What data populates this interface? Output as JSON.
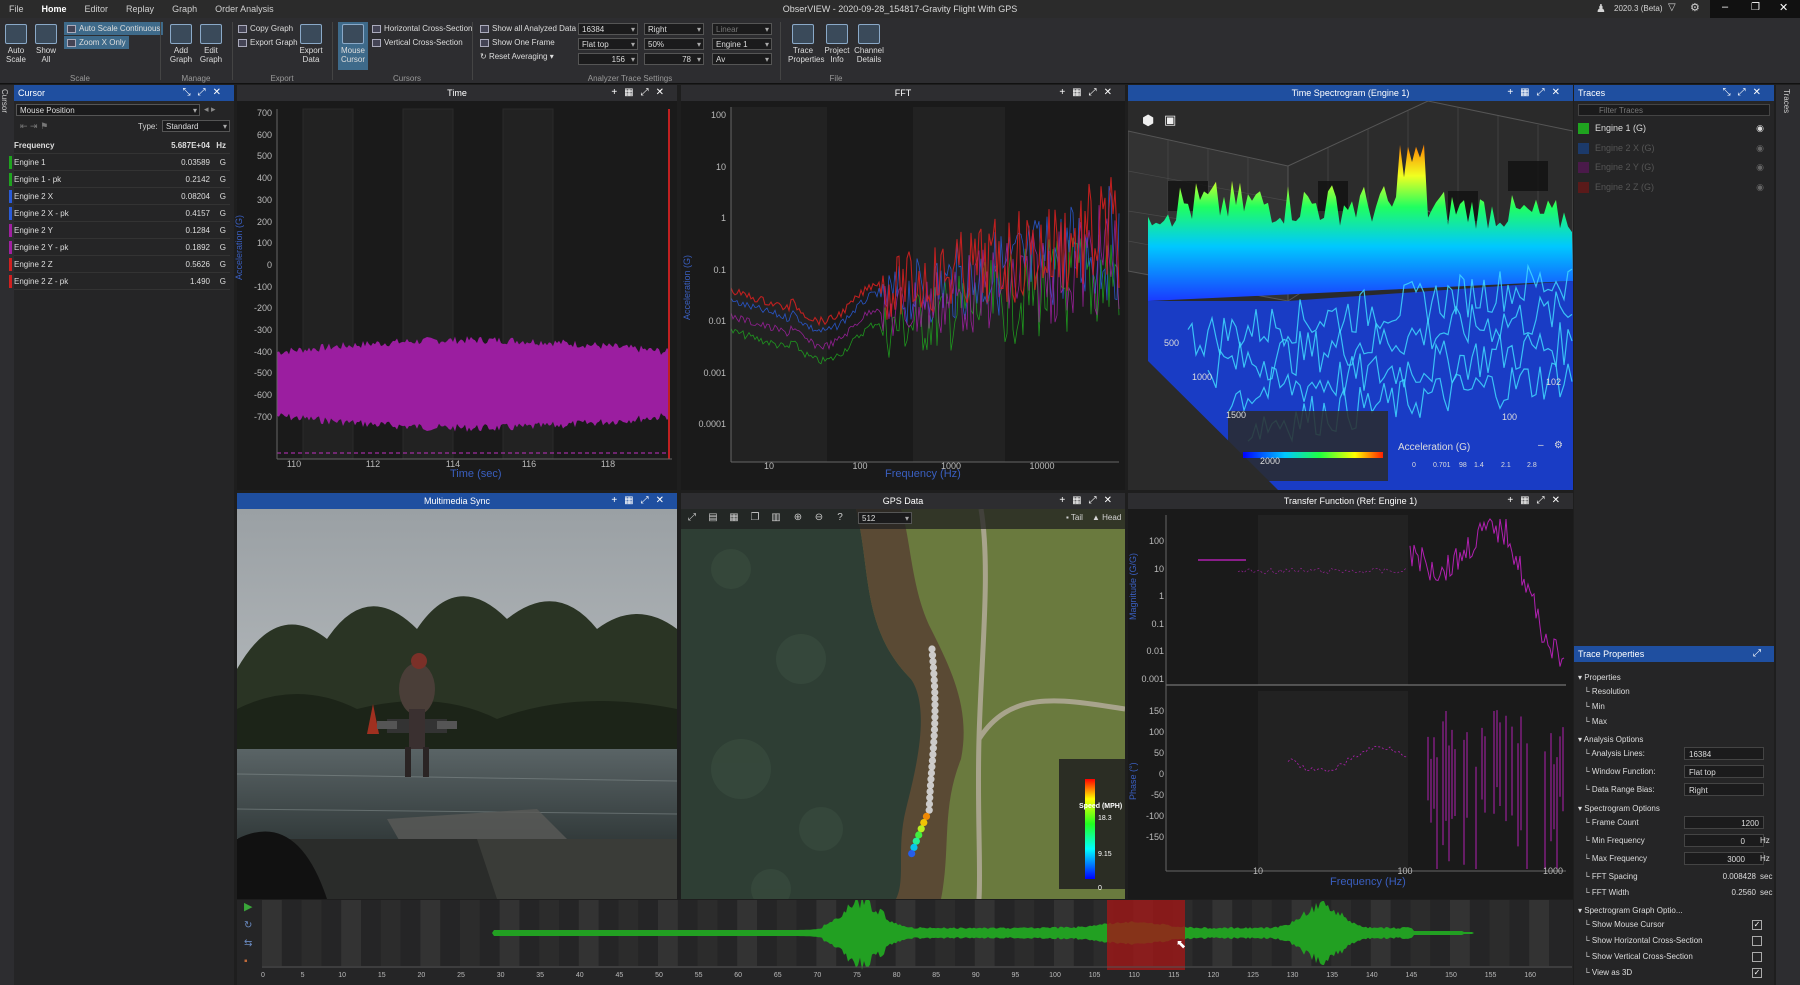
{
  "menu": {
    "tabs": [
      "File",
      "Home",
      "Editor",
      "Replay",
      "Graph",
      "Order Analysis"
    ],
    "active": "Home"
  },
  "window": {
    "title": "ObserVIEW - 2020-09-28_154817-Gravity Flight With GPS",
    "version": "2020.3 (Beta)"
  },
  "ribbon": {
    "auto_scale": "Auto Scale",
    "show_all": "Show All",
    "auto_scale_continuous": "Auto Scale Continuous",
    "zoom_x_only": "Zoom X Only",
    "add_graph": "Add Graph",
    "edit_graph": "Edit Graph",
    "copy_graph": "Copy Graph",
    "export_graph": "Export Graph",
    "export_data": "Export Data",
    "mouse_cursor": "Mouse Cursor",
    "horizontal_cross_section": "Horizontal Cross-Section",
    "vertical_cross_section": "Vertical Cross-Section",
    "show_all_analyzed": "Show all Analyzed Data",
    "show_one_frame": "Show One Frame",
    "reset_averaging": "Reset Averaging",
    "dd_lines": "16384",
    "dd_window": "Flat top",
    "dd_frames": "156",
    "dd_bias": "Right",
    "dd_overlap": "50%",
    "dd_avg": "78",
    "dd_scale": "Linear",
    "dd_ref": "Engine 1",
    "dd_type": "Av",
    "trace_properties": "Trace Properties",
    "project_info": "Project Info",
    "channel_details": "Channel Details",
    "groups": {
      "scale": "Scale",
      "manage": "Manage",
      "export": "Export",
      "cursors": "Cursors",
      "analyzer": "Analyzer Trace Settings",
      "file": "File"
    }
  },
  "cursor_panel": {
    "title": "Cursor",
    "mode": "Mouse Position",
    "type_label": "Type:",
    "type_value": "Standard",
    "header_label": "Frequency",
    "header_value": "5.687E+04",
    "header_unit": "Hz",
    "rows": [
      {
        "label": "Engine 1",
        "value": "0.03589",
        "unit": "G",
        "color": "#1fa31f"
      },
      {
        "label": "Engine 1 - pk",
        "value": "0.2142",
        "unit": "G",
        "color": "#1fa31f"
      },
      {
        "label": "Engine 2 X",
        "value": "0.08204",
        "unit": "G",
        "color": "#2a5bd8"
      },
      {
        "label": "Engine 2 X - pk",
        "value": "0.4157",
        "unit": "G",
        "color": "#2a5bd8"
      },
      {
        "label": "Engine 2 Y",
        "value": "0.1284",
        "unit": "G",
        "color": "#a020a0"
      },
      {
        "label": "Engine 2 Y - pk",
        "value": "0.1892",
        "unit": "G",
        "color": "#a020a0"
      },
      {
        "label": "Engine 2 Z",
        "value": "0.5626",
        "unit": "G",
        "color": "#d02020"
      },
      {
        "label": "Engine 2 Z - pk",
        "value": "1.490",
        "unit": "G",
        "color": "#d02020"
      }
    ]
  },
  "time_panel": {
    "title": "Time",
    "ylabel": "Acceleration (G)",
    "xlabel": "Time (sec)",
    "yticks": [
      "700",
      "600",
      "500",
      "400",
      "300",
      "200",
      "100",
      "0",
      "-100",
      "-200",
      "-300",
      "-400",
      "-500",
      "-600",
      "-700"
    ],
    "xticks": [
      "110",
      "112",
      "114",
      "116",
      "118"
    ]
  },
  "fft_panel": {
    "title": "FFT",
    "ylabel": "Acceleration (G)",
    "xlabel": "Frequency (Hz)",
    "yticks": [
      "100",
      "10",
      "1",
      "0.1",
      "0.01",
      "0.001",
      "0.0001"
    ],
    "xticks": [
      "10",
      "100",
      "1000",
      "10000"
    ]
  },
  "spectrogram_panel": {
    "title": "Time Spectrogram (Engine 1)",
    "axis_labels": [
      "500",
      "1000",
      "1500",
      "2000",
      "100",
      "102"
    ],
    "legend_title": "Acceleration (G)",
    "legend_ticks": [
      "0",
      "0.701",
      "98",
      "1.4",
      "2.1",
      "2.8"
    ]
  },
  "multimedia_panel": {
    "title": "Multimedia Sync"
  },
  "gps_panel": {
    "title": "GPS Data",
    "zoom": "512",
    "tail": "Tail",
    "head": "Head",
    "speed_title": "Speed (MPH)",
    "speed_ticks": [
      "18.3",
      "9.15",
      "0"
    ]
  },
  "transfer_panel": {
    "title": "Transfer Function (Ref: Engine 1)",
    "ylabel_top": "Magnitude (G/G)",
    "ylabel_bottom": "Phase (°)",
    "xlabel": "Frequency (Hz)",
    "yticks_top": [
      "100",
      "10",
      "1",
      "0.1",
      "0.01",
      "0.001"
    ],
    "yticks_bottom": [
      "150",
      "100",
      "50",
      "0",
      "-50",
      "-100",
      "-150"
    ],
    "xticks": [
      "10",
      "100",
      "1000"
    ]
  },
  "traces_panel": {
    "title": "Traces",
    "filter_placeholder": "Filter Traces",
    "items": [
      {
        "label": "Engine 1 (G)",
        "color": "#1fa31f",
        "active": true
      },
      {
        "label": "Engine 2 X (G)",
        "color": "#1c3a6a",
        "active": false
      },
      {
        "label": "Engine 2 Y (G)",
        "color": "#4a1a4a",
        "active": false
      },
      {
        "label": "Engine 2 Z (G)",
        "color": "#5a1a1a",
        "active": false
      }
    ]
  },
  "trace_properties": {
    "title": "Trace Properties",
    "sections": {
      "properties": "Properties",
      "analysis": "Analysis Options",
      "spectrogram": "Spectrogram Options",
      "graph": "Spectrogram Graph Optio..."
    },
    "resolution": "Resolution",
    "min": "Min",
    "max": "Max",
    "analysis_lines": {
      "label": "Analysis Lines:",
      "value": "16384"
    },
    "window_function": {
      "label": "Window Function:",
      "value": "Flat top"
    },
    "data_range_bias": {
      "label": "Data Range Bias:",
      "value": "Right"
    },
    "frame_count": {
      "label": "Frame Count",
      "value": "1200"
    },
    "min_frequency": {
      "label": "Min Frequency",
      "value": "0",
      "unit": "Hz"
    },
    "max_frequency": {
      "label": "Max Frequency",
      "value": "3000",
      "unit": "Hz"
    },
    "fft_spacing": {
      "label": "FFT Spacing",
      "value": "0.008428",
      "unit": "sec"
    },
    "fft_width": {
      "label": "FFT Width",
      "value": "0.2560",
      "unit": "sec"
    },
    "checks": [
      {
        "label": "Show Mouse Cursor",
        "checked": true
      },
      {
        "label": "Show Horizontal Cross-Section",
        "checked": false
      },
      {
        "label": "Show Vertical Cross-Section",
        "checked": false
      },
      {
        "label": "View as 3D",
        "checked": true
      }
    ]
  },
  "timeline": {
    "ticks": [
      "0",
      "5",
      "10",
      "15",
      "20",
      "25",
      "30",
      "35",
      "40",
      "45",
      "50",
      "55",
      "60",
      "65",
      "70",
      "75",
      "80",
      "85",
      "90",
      "95",
      "100",
      "105",
      "110",
      "115",
      "120",
      "125",
      "130",
      "135",
      "140",
      "145",
      "150",
      "155",
      "160"
    ]
  }
}
